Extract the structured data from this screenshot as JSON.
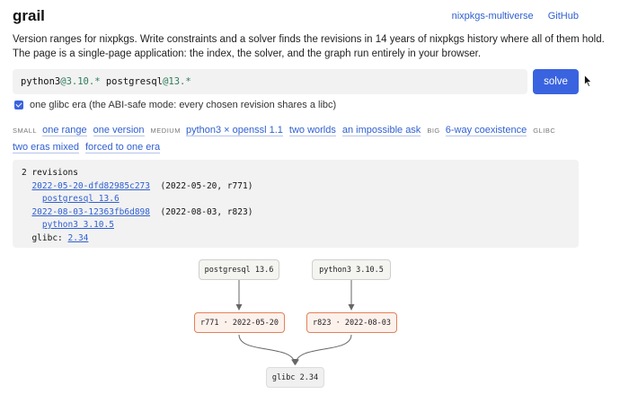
{
  "header": {
    "brand": "grail",
    "links": [
      "nixpkgs-multiverse",
      "GitHub"
    ]
  },
  "intro": {
    "line1": "Version ranges for nixpkgs. Write constraints and a solver finds the revisions in 14 years of nixpkgs history where all of them hold.",
    "line2": "The page is a single-page application: the index, the solver, and the graph run entirely in your browser."
  },
  "query": {
    "p1_name": "python3",
    "p1_ver": "@3.10.*",
    "p2_name": "postgresql",
    "p2_ver": "@13.*",
    "solve_label": "solve"
  },
  "abi": {
    "checked": true,
    "label": "one glibc era (the ABI-safe mode: every chosen revision shares a libc)"
  },
  "presets": {
    "small": "SMALL",
    "small_items": [
      "one range",
      "one version"
    ],
    "medium": "MEDIUM",
    "medium_items": [
      "python3 × openssl 1.1",
      "two worlds",
      "an impossible ask"
    ],
    "big": "BIG",
    "big_items": [
      "6-way coexistence"
    ],
    "glibc": "GLIBC",
    "glibc_items": [
      "two eras mixed",
      "forced to one era"
    ]
  },
  "result": {
    "count": "2 revisions",
    "rev1": "2022-05-20-dfd82985c273",
    "rev1_meta": "(2022-05-20, r771)",
    "rev1_pkg": "postgresql 13.6",
    "rev2": "2022-08-03-12363fb6d898",
    "rev2_meta": "(2022-08-03, r823)",
    "rev2_pkg": "python3 3.10.5",
    "glibc_label": "glibc:",
    "glibc_ver": "2.34"
  },
  "graph": {
    "pkg1": "postgresql 13.6",
    "pkg2": "python3 3.10.5",
    "rev1": "r771 · 2022-05-20",
    "rev2": "r823 · 2022-08-03",
    "lib": "glibc 2.34"
  }
}
